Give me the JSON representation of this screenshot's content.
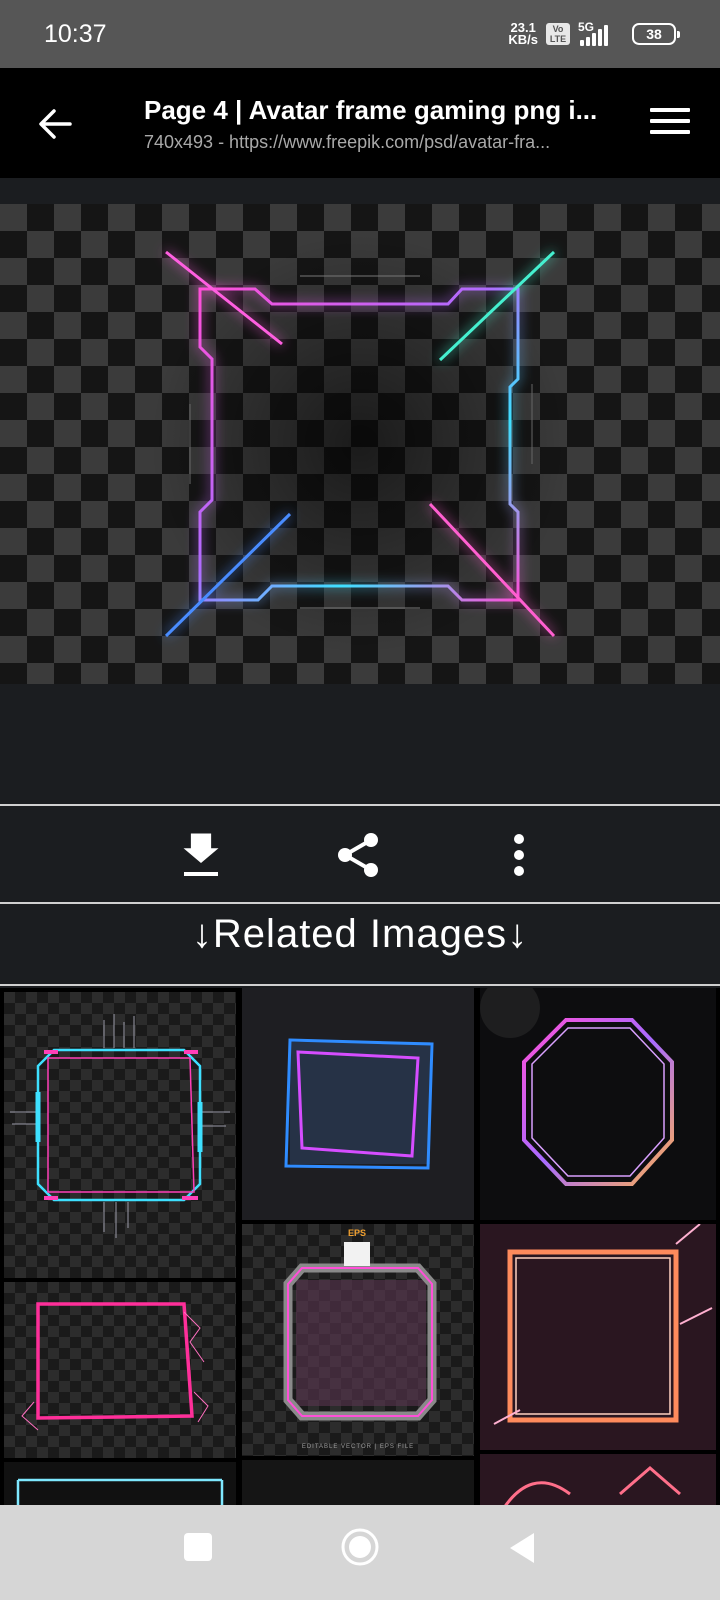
{
  "status_bar": {
    "time": "10:37",
    "net_speed_value": "23.1",
    "net_speed_unit": "KB/s",
    "volte_line1": "Vo",
    "volte_line2": "LTE",
    "network": "5G",
    "battery": "38"
  },
  "header": {
    "title": "Page 4 | Avatar frame gaming png i...",
    "subtitle": "740x493 - https://www.freepik.com/psd/avatar-fra..."
  },
  "actions": {
    "download_icon": "download-icon",
    "share_icon": "share-icon",
    "more_icon": "more-vertical-icon"
  },
  "related": {
    "title": "↓Related Images↓",
    "eps_label": "EPS",
    "tile_caption": "EDITABLE VECTOR | EPS FILE"
  },
  "nav_bar": {
    "recents_icon": "square-icon",
    "home_icon": "circle-icon",
    "back_icon": "triangle-back-icon"
  },
  "colors": {
    "status_bar": "#565656",
    "app_bar": "#000000",
    "background": "#1b1d20",
    "nav_bar": "#d6d6d6",
    "neon_pink": "#ff4fd8",
    "neon_cyan": "#3ee0ff",
    "neon_blue": "#3a7bff"
  }
}
